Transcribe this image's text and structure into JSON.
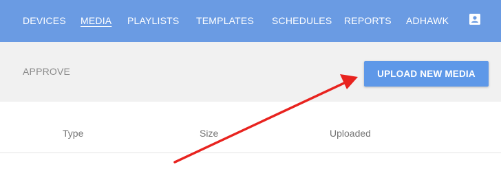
{
  "nav": {
    "items": [
      {
        "label": "DEVICES",
        "active": false
      },
      {
        "label": "MEDIA",
        "active": true
      },
      {
        "label": "PLAYLISTS",
        "active": false
      },
      {
        "label": "TEMPLATES",
        "active": false
      },
      {
        "label": "SCHEDULES",
        "active": false
      },
      {
        "label": "REPORTS",
        "active": false
      },
      {
        "label": "ADHAWK",
        "active": false
      }
    ],
    "account_icon": "account-box-icon"
  },
  "toolbar": {
    "approve_label": "APPROVE",
    "upload_label": "UPLOAD NEW MEDIA"
  },
  "table": {
    "columns": [
      "Type",
      "Size",
      "Uploaded"
    ]
  },
  "annotation": {
    "arrow_color": "#e8231f"
  },
  "colors": {
    "nav_bg": "#6a9be3",
    "button_bg": "#5e98e8",
    "toolbar_bg": "#f1f1f1"
  }
}
